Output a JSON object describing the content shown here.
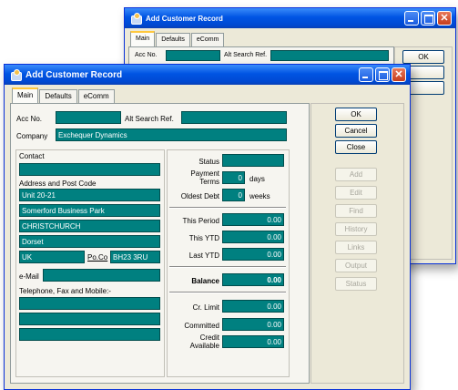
{
  "back_window": {
    "title": "Add Customer Record",
    "tabs": [
      "Main",
      "Defaults",
      "eComm"
    ],
    "acc_no_label": "Acc No.",
    "alt_search_label": "Alt Search Ref.",
    "ok_label": "OK"
  },
  "window": {
    "title": "Add Customer Record",
    "tabs": [
      "Main",
      "Defaults",
      "eComm"
    ]
  },
  "form": {
    "acc_no_label": "Acc No.",
    "acc_no_value": "",
    "alt_search_label": "Alt Search Ref.",
    "alt_search_value": "",
    "company_label": "Company",
    "company_value": "Exchequer Dynamics",
    "contact_label": "Contact",
    "contact_value": "",
    "address_label": "Address and Post Code",
    "address_lines": [
      "Unit 20-21",
      "Somerford Business Park",
      "CHRISTCHURCH",
      "Dorset",
      "UK"
    ],
    "postcode_label": "Po.Co",
    "postcode_value": "BH23 3RU",
    "email_label": "e-Mail",
    "email_value": "",
    "phone_label": "Telephone, Fax and Mobile:-",
    "phone_values": [
      "",
      "",
      ""
    ]
  },
  "financial": {
    "status_label": "Status",
    "status_value": "",
    "payment_terms_label": "Payment Terms",
    "payment_terms_value": "0",
    "payment_terms_unit": "days",
    "oldest_debt_label": "Oldest Debt",
    "oldest_debt_value": "0",
    "oldest_debt_unit": "weeks",
    "this_period_label": "This Period",
    "this_period_value": "0.00",
    "this_ytd_label": "This YTD",
    "this_ytd_value": "0.00",
    "last_ytd_label": "Last YTD",
    "last_ytd_value": "0.00",
    "balance_label": "Balance",
    "balance_value": "0.00",
    "cr_limit_label": "Cr. Limit",
    "cr_limit_value": "0.00",
    "committed_label": "Committed",
    "committed_value": "0.00",
    "credit_available_label": "Credit Available",
    "credit_available_value": "0.00"
  },
  "buttons": {
    "ok": "OK",
    "cancel": "Cancel",
    "close": "Close",
    "add": "Add",
    "edit": "Edit",
    "find": "Find",
    "history": "History",
    "links": "Links",
    "output": "Output",
    "status": "Status"
  },
  "colors": {
    "field_teal": "#008080",
    "title_blue": "#0054e3",
    "dialog_bg": "#ece9d8"
  }
}
